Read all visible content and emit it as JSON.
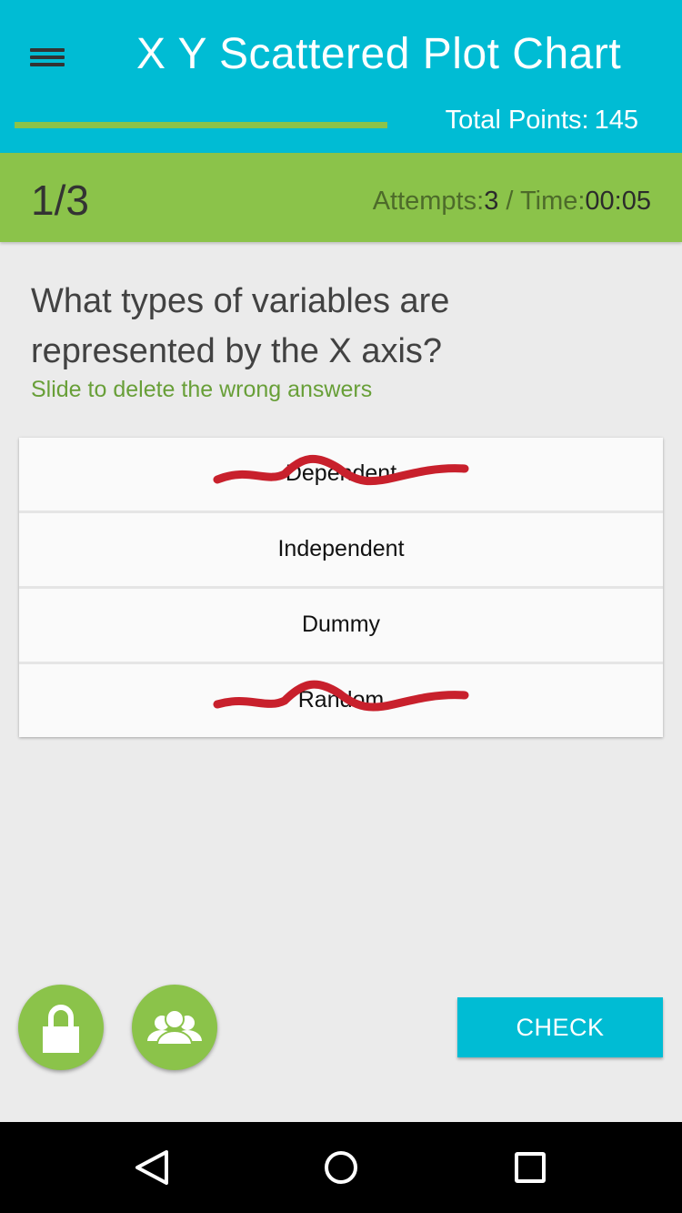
{
  "header": {
    "title": "X Y Scattered Plot Chart",
    "menu_icon": "hamburger-menu-icon",
    "progress_fraction": 1.0,
    "total_points_label": "Total Points:",
    "total_points_value": "145"
  },
  "status": {
    "counter": "1/3",
    "attempts_label": "Attempts:",
    "attempts_value": "3",
    "separator": " / ",
    "time_label": "Time:",
    "time_value": "00:05"
  },
  "question": {
    "text": "What types of variables are represented by the X axis?",
    "hint": "Slide to delete the wrong answers"
  },
  "answers": [
    {
      "label": "Dependent",
      "struck": true
    },
    {
      "label": "Independent",
      "struck": false
    },
    {
      "label": "Dummy",
      "struck": false
    },
    {
      "label": "Random",
      "struck": true
    }
  ],
  "actions": {
    "lock_icon": "lock-icon",
    "people_icon": "people-icon",
    "check_label": "CHECK"
  },
  "colors": {
    "header": "#00bcd4",
    "accent_green": "#8bc34a",
    "hint_green": "#689f38",
    "strike_red": "#c8202c",
    "check_button": "#00bcd4"
  },
  "navbar": {
    "back_icon": "back-triangle-icon",
    "home_icon": "home-circle-icon",
    "recent_icon": "recent-apps-square-icon"
  }
}
